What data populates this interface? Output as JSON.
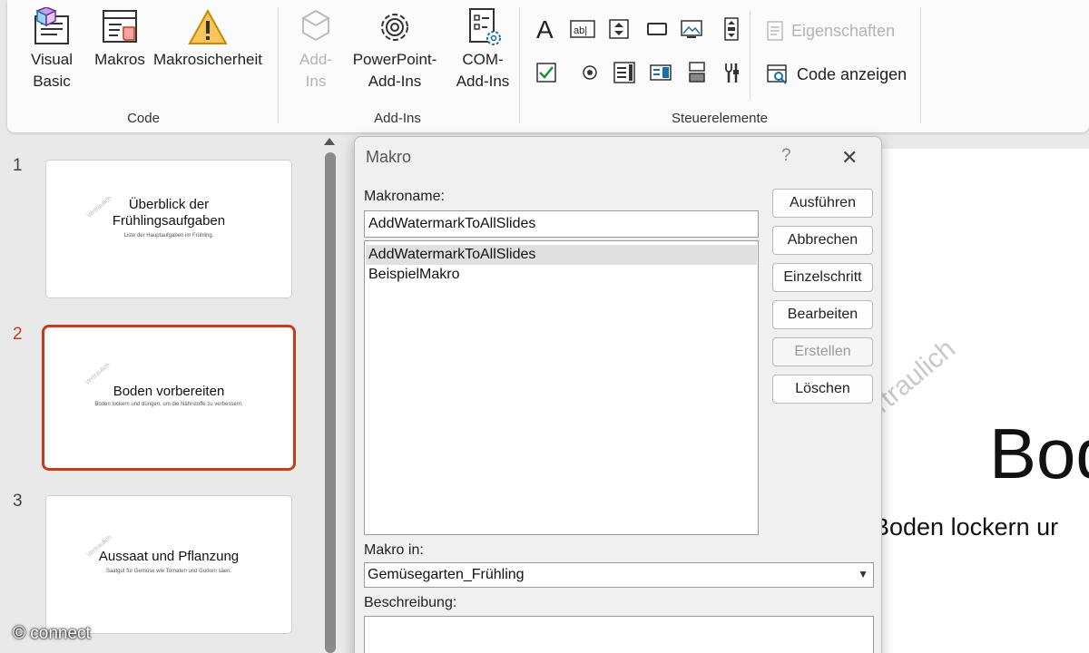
{
  "ribbon": {
    "code_group": {
      "label": "Code",
      "visual_basic": "Visual\nBasic",
      "makros": "Makros",
      "makrosicherheit": "Makrosicherheit"
    },
    "addins_group": {
      "label": "Add-Ins",
      "addins": "Add-\nIns",
      "powerpoint_addins": "PowerPoint-\nAdd-Ins",
      "com_addins": "COM-\nAdd-Ins"
    },
    "controls_group": {
      "label": "Steuerelemente",
      "eigenschaften": "Eigenschaften",
      "code_anzeigen": "Code anzeigen"
    }
  },
  "slides": [
    {
      "number": "1",
      "title": "Überblick der\nFrühlingsaufgaben",
      "subtitle": "Liste der Hauptaufgaben im Frühling.",
      "watermark": "Vertraulich"
    },
    {
      "number": "2",
      "title": "Boden vorbereiten",
      "subtitle": "Boden lockern und düngen, um die Nährstoffe zu verbessern.",
      "watermark": "Vertraulich"
    },
    {
      "number": "3",
      "title": "Aussaat und Pflanzung",
      "subtitle": "Saatgut für Gemüse wie Tomaten und Gurken säen.",
      "watermark": "Vertraulich"
    }
  ],
  "main_slide": {
    "watermark": "Vertraulich",
    "title": "Bod",
    "subtitle": "Boden lockern ur"
  },
  "dialog": {
    "title": "Makro",
    "help": "?",
    "close": "✕",
    "makroname_label": "Makroname:",
    "makroname_value": "AddWatermarkToAllSlides",
    "macros": [
      "AddWatermarkToAllSlides",
      "BeispielMakro"
    ],
    "buttons": {
      "ausfuehren": "Ausführen",
      "abbrechen": "Abbrechen",
      "einzelschritt": "Einzelschritt",
      "bearbeiten": "Bearbeiten",
      "erstellen": "Erstellen",
      "loeschen": "Löschen"
    },
    "makro_in_label": "Makro in:",
    "makro_in_value": "Gemüsegarten_Frühling",
    "beschreibung_label": "Beschreibung:"
  },
  "credit": "© connect",
  "colors": {
    "accent": "#c43e1c",
    "ribbon_bg": "#fbfbfb",
    "dialog_bg": "#f0f0f0"
  }
}
